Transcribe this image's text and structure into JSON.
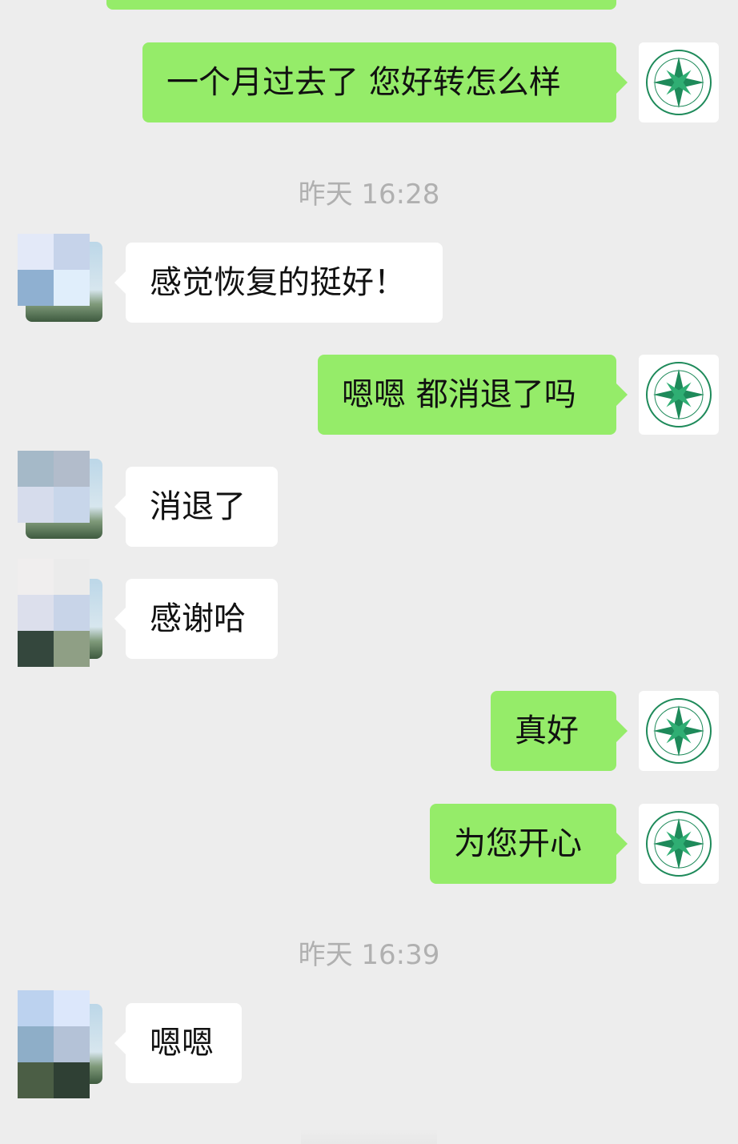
{
  "colors": {
    "background": "#ededed",
    "sent_bubble": "#95ec69",
    "received_bubble": "#ffffff",
    "timestamp": "#b0b0b0"
  },
  "chat": {
    "msg_sent_1": "一个月过去了 您好转怎么样",
    "time_1": "昨天 16:28",
    "msg_recv_1": "感觉恢复的挺好！",
    "msg_sent_2": "嗯嗯 都消退了吗",
    "msg_recv_2": "消退了",
    "msg_recv_3": "感谢哈",
    "msg_sent_3": "真好",
    "msg_sent_4": "为您开心",
    "time_2": "昨天 16:39",
    "msg_recv_4": "嗯嗯"
  },
  "icons": {
    "sender_avatar": "green-compass-logo-avatar",
    "contact_avatar": "pixelated-landscape-avatar"
  }
}
